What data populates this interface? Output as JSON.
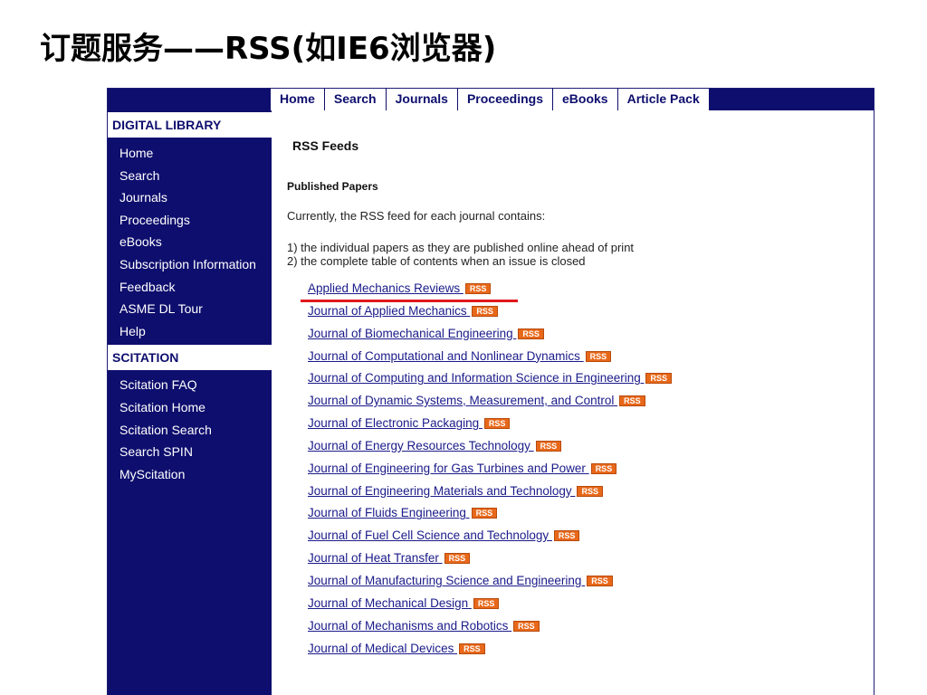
{
  "slide_title": "订题服务——RSS(如IE6浏览器)",
  "top_nav": [
    "Home",
    "Search",
    "Journals",
    "Proceedings",
    "eBooks",
    "Article Pack"
  ],
  "sidebar": {
    "digital_library_header": "DIGITAL LIBRARY",
    "digital_library_items": [
      "Home",
      "Search",
      "Journals",
      "Proceedings",
      "eBooks",
      "Subscription Information",
      "Feedback",
      "ASME DL Tour",
      "Help"
    ],
    "scitation_header": "SCITATION",
    "scitation_items": [
      "Scitation FAQ",
      "Scitation Home",
      "Scitation Search",
      "Search SPIN",
      "MyScitation"
    ]
  },
  "content": {
    "rss_heading": "RSS Feeds",
    "published_heading": "Published Papers",
    "intro": "Currently, the RSS feed for each journal contains:",
    "bullets": [
      "1) the individual papers as they are published online ahead of print",
      "2) the complete table of contents when an issue is closed"
    ],
    "rss_badge_label": "RSS",
    "journals": [
      "Applied Mechanics Reviews",
      "Journal of Applied Mechanics",
      "Journal of Biomechanical Engineering",
      "Journal of Computational and Nonlinear Dynamics",
      "Journal of Computing and Information Science in Engineering",
      "Journal of Dynamic Systems, Measurement, and Control",
      "Journal of Electronic Packaging",
      "Journal of Energy Resources Technology",
      "Journal of Engineering for Gas Turbines and Power",
      "Journal of Engineering Materials and Technology",
      "Journal of Fluids Engineering",
      "Journal of Fuel Cell Science and Technology",
      "Journal of Heat Transfer",
      "Journal of Manufacturing Science and Engineering",
      "Journal of Mechanical Design",
      "Journal of Mechanisms and Robotics",
      "Journal of Medical Devices"
    ]
  },
  "colors": {
    "nav_blue": "#0e0e6e",
    "link_blue": "#1a1a8a",
    "rss_orange": "#e8681a",
    "highlight_red": "#e0191e"
  }
}
